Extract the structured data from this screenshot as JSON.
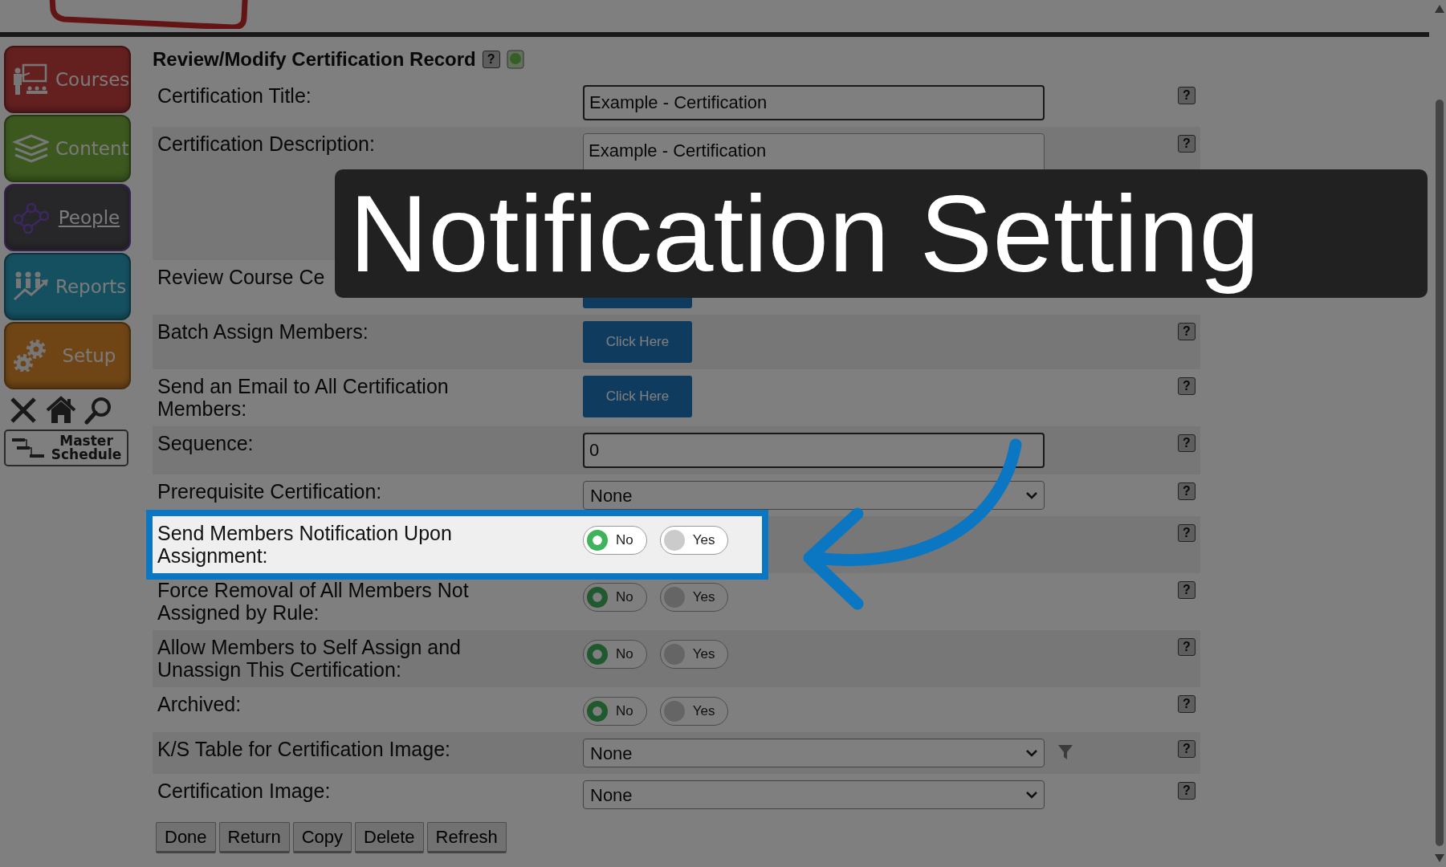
{
  "header": {
    "title": "Review/Modify Certification Record",
    "help": "?"
  },
  "sidebar": [
    {
      "label": "Courses",
      "selected": false
    },
    {
      "label": "Content",
      "selected": false
    },
    {
      "label": "People",
      "selected": true
    },
    {
      "label": "Reports",
      "selected": false
    },
    {
      "label": "Setup",
      "selected": false
    }
  ],
  "master_schedule": "Master Schedule",
  "rows": [
    {
      "kind": "text",
      "label": "Certification Title:",
      "value": "Example - Certification",
      "help": "?",
      "highlighted": false
    },
    {
      "kind": "textarea",
      "label": "Certification Description:",
      "value": "Example - Certification",
      "help": "?",
      "highlighted": false
    },
    {
      "kind": "button",
      "label": "Review Course Ce",
      "highlighted": false
    },
    {
      "kind": "button",
      "label": "Batch Assign Members:",
      "button": "Click Here",
      "help": "?",
      "highlighted": false
    },
    {
      "kind": "button",
      "label": "Send an Email to All Certification Members:",
      "button": "Click Here",
      "help": "?",
      "highlighted": false
    },
    {
      "kind": "text",
      "label": "Sequence:",
      "value": "0",
      "help": "?",
      "highlighted": false
    },
    {
      "kind": "select",
      "label": "Prerequisite Certification:",
      "value": "None",
      "filter": false,
      "help": "?",
      "highlighted": false
    },
    {
      "kind": "toggle",
      "label": "Send Members Notification Upon Assignment:",
      "options": [
        {
          "label": "No",
          "selected": true
        },
        {
          "label": "Yes",
          "selected": false
        }
      ],
      "help": "?",
      "highlighted": true
    },
    {
      "kind": "toggle",
      "label": "Force Removal of All Members Not Assigned by Rule:",
      "options": [
        {
          "label": "No",
          "selected": true
        },
        {
          "label": "Yes",
          "selected": false
        }
      ],
      "help": "?",
      "highlighted": false
    },
    {
      "kind": "toggle",
      "label": "Allow Members to Self Assign and Unassign This Certification:",
      "options": [
        {
          "label": "No",
          "selected": true
        },
        {
          "label": "Yes",
          "selected": false
        }
      ],
      "help": "?",
      "highlighted": false
    },
    {
      "kind": "toggle",
      "label": "Archived:",
      "options": [
        {
          "label": "No",
          "selected": true
        },
        {
          "label": "Yes",
          "selected": false
        }
      ],
      "help": "?",
      "highlighted": false
    },
    {
      "kind": "select",
      "label": "K/S Table for Certification Image:",
      "value": "None",
      "filter": true,
      "help": "?",
      "highlighted": false
    },
    {
      "kind": "select",
      "label": "Certification Image:",
      "value": "None",
      "filter": false,
      "help": "?",
      "highlighted": false
    }
  ],
  "actions": [
    "Done",
    "Return",
    "Copy",
    "Delete",
    "Refresh"
  ],
  "annotation": {
    "title": "Notification Setting"
  }
}
